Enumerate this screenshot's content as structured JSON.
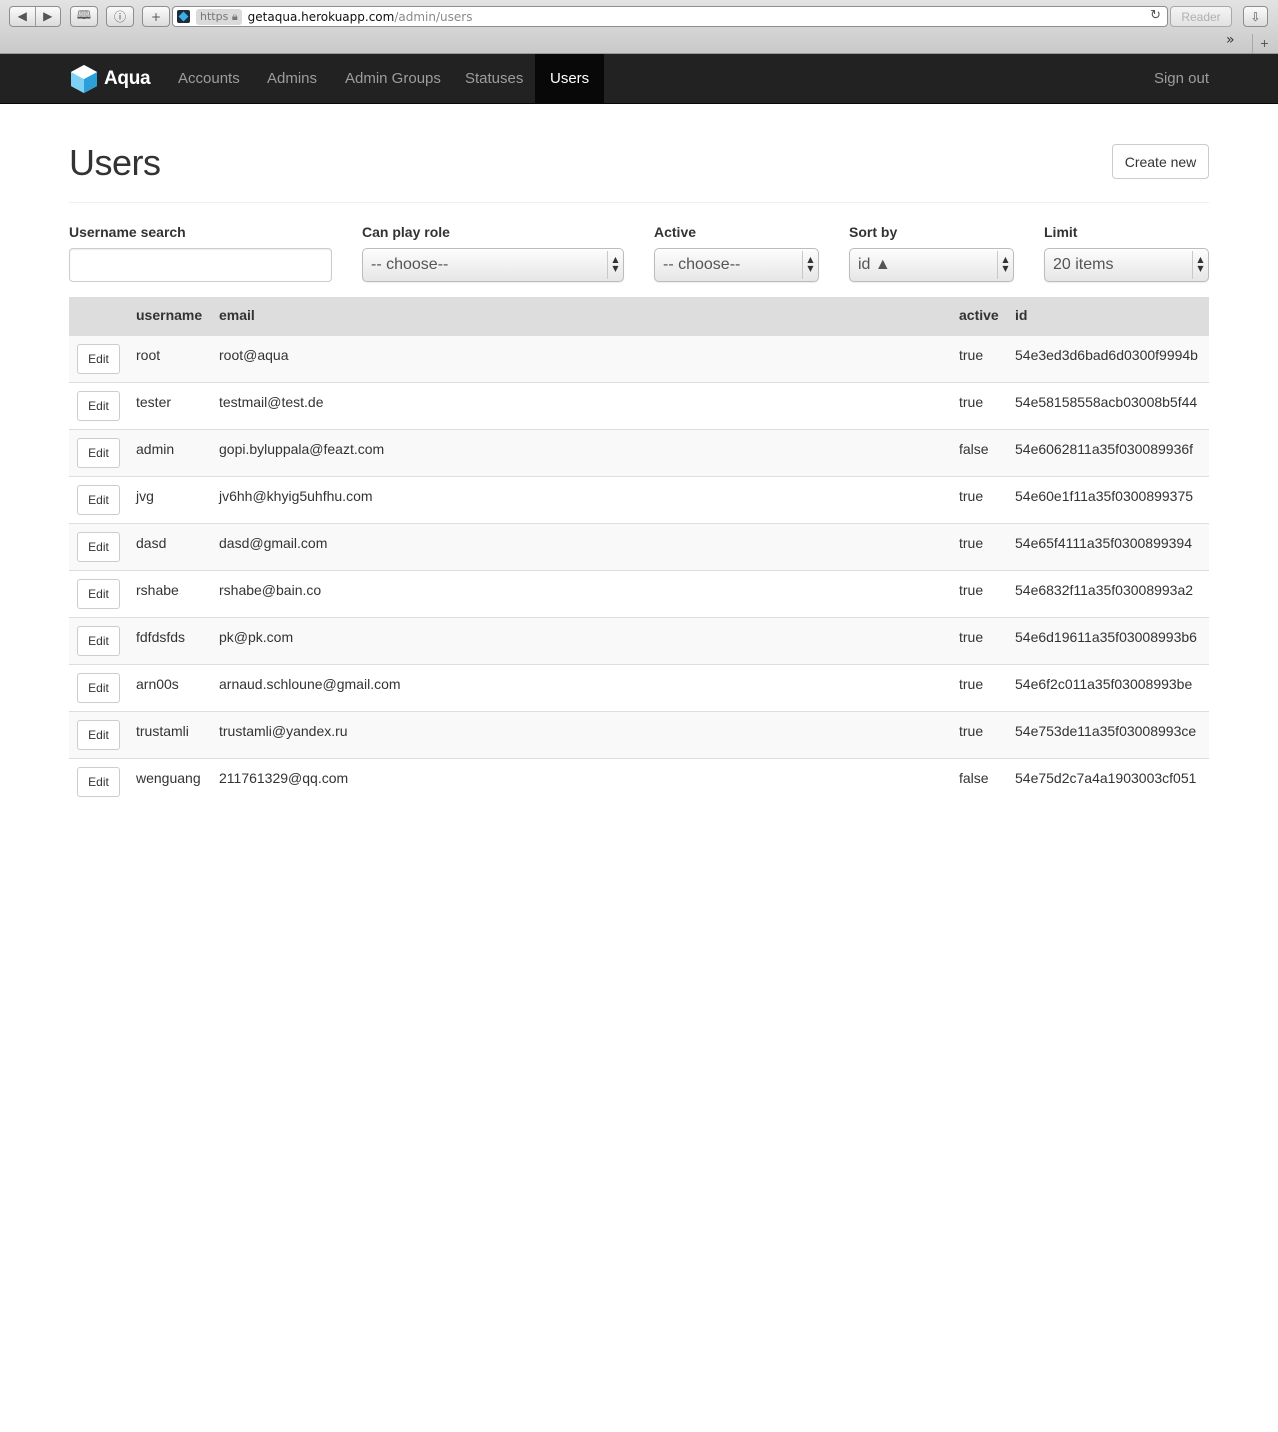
{
  "browser": {
    "back_icon": "◀",
    "forward_icon": "▶",
    "url_scheme": "https",
    "url_host": "getaqua.herokuapp.com",
    "url_path": "/admin/users",
    "reader_label": "Reader",
    "reload_icon": "↻",
    "overflow_icon": "»",
    "new_tab_icon": "+"
  },
  "navbar": {
    "brand": "Aqua",
    "items": [
      {
        "label": "Accounts"
      },
      {
        "label": "Admins"
      },
      {
        "label": "Admin Groups"
      },
      {
        "label": "Statuses"
      },
      {
        "label": "Users",
        "active": true
      }
    ],
    "sign_out": "Sign out"
  },
  "page": {
    "title": "Users",
    "create_button": "Create new"
  },
  "filters": {
    "username_search": {
      "label": "Username search",
      "value": ""
    },
    "can_play_role": {
      "label": "Can play role",
      "value": "-- choose--"
    },
    "active": {
      "label": "Active",
      "value": "-- choose--"
    },
    "sort_by": {
      "label": "Sort by",
      "value": "id ▲"
    },
    "limit": {
      "label": "Limit",
      "value": "20 items"
    }
  },
  "table": {
    "columns": [
      "username",
      "email",
      "active",
      "id"
    ],
    "edit_label": "Edit",
    "rows": [
      {
        "username": "root",
        "email": "root@aqua",
        "active": "true",
        "id": "54e3ed3d6bad6d0300f9994b"
      },
      {
        "username": "tester",
        "email": "testmail@test.de",
        "active": "true",
        "id": "54e58158558acb03008b5f44"
      },
      {
        "username": "admin",
        "email": "gopi.byluppala@feazt.com",
        "active": "false",
        "id": "54e6062811a35f030089936f"
      },
      {
        "username": "jvg",
        "email": "jv6hh@khyig5uhfhu.com",
        "active": "true",
        "id": "54e60e1f11a35f0300899375"
      },
      {
        "username": "dasd",
        "email": "dasd@gmail.com",
        "active": "true",
        "id": "54e65f4111a35f0300899394"
      },
      {
        "username": "rshabe",
        "email": "rshabe@bain.co",
        "active": "true",
        "id": "54e6832f11a35f03008993a2"
      },
      {
        "username": "fdfdsfds",
        "email": "pk@pk.com",
        "active": "true",
        "id": "54e6d19611a35f03008993b6"
      },
      {
        "username": "arn00s",
        "email": "arnaud.schloune@gmail.com",
        "active": "true",
        "id": "54e6f2c011a35f03008993be"
      },
      {
        "username": "trustamli",
        "email": "trustamli@yandex.ru",
        "active": "true",
        "id": "54e753de11a35f03008993ce"
      },
      {
        "username": "wenguang",
        "email": "211761329@qq.com",
        "active": "false",
        "id": "54e75d2c7a4a1903003cf051"
      }
    ]
  },
  "colors": {
    "navbar_bg": "#222222",
    "navbar_active_bg": "#080808",
    "table_header_bg": "#dddddd",
    "logo_blue": "#3aaee6"
  }
}
